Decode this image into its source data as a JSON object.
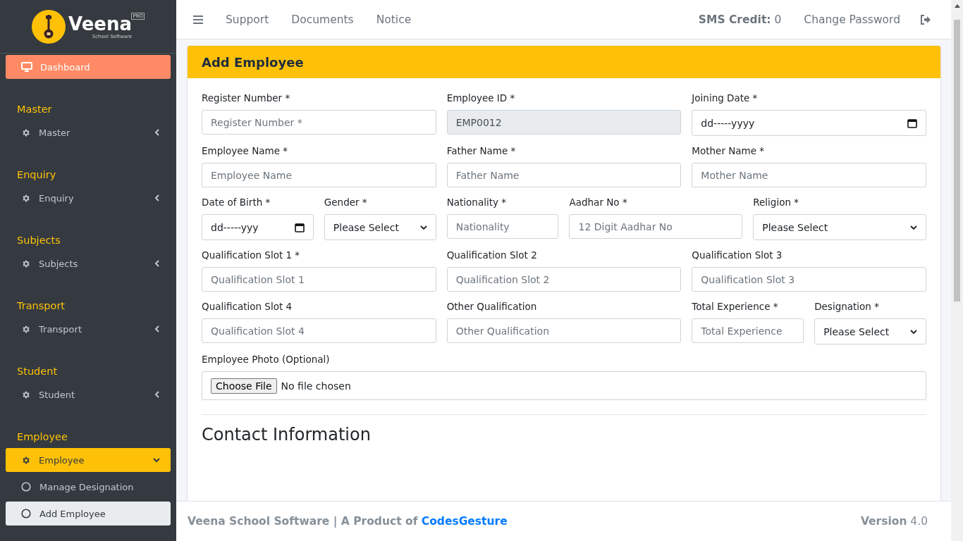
{
  "sidebar": {
    "logo": {
      "name": "Veena",
      "tagline": "School Software",
      "badge": "PRO"
    },
    "dashboard": {
      "label": "Dashboard"
    },
    "sections": [
      {
        "heading": "Master",
        "menu": {
          "label": "Master",
          "expanded": false
        }
      },
      {
        "heading": "Enquiry",
        "menu": {
          "label": "Enquiry",
          "expanded": false
        }
      },
      {
        "heading": "Subjects",
        "menu": {
          "label": "Subjects",
          "expanded": false
        }
      },
      {
        "heading": "Transport",
        "menu": {
          "label": "Transport",
          "expanded": false
        }
      },
      {
        "heading": "Student",
        "menu": {
          "label": "Student",
          "expanded": false
        }
      },
      {
        "heading": "Employee",
        "menu": {
          "label": "Employee",
          "expanded": true
        },
        "children": [
          {
            "label": "Manage Designation",
            "selected": false
          },
          {
            "label": "Add Employee",
            "selected": true
          }
        ]
      }
    ]
  },
  "top_nav": {
    "links": [
      "Support",
      "Documents",
      "Notice"
    ],
    "sms_credit": "**SMS Credit:** 0",
    "change_password": "Change Password"
  },
  "form": {
    "title": "Add Employee",
    "fields": [
      {
        "label": "Register Number *",
        "kind": "text",
        "placeholder": "Register Number *",
        "disabled": false
      },
      {
        "label": "Employee ID *",
        "kind": "text",
        "value": "EMP0012",
        "disabled": true
      },
      {
        "label": "Joining Date *",
        "kind": "date",
        "value": "dd-----yyyy",
        "disabled": false
      },
      {
        "label": "Employee Name *",
        "kind": "text",
        "placeholder": "Employee Name",
        "disabled": false
      },
      {
        "label": "Father Name *",
        "kind": "text",
        "placeholder": "Father Name",
        "disabled": false
      },
      {
        "label": "Mother Name *",
        "kind": "text",
        "placeholder": "Mother Name",
        "disabled": false
      },
      {
        "label": "Date of Birth *",
        "kind": "date",
        "value": "dd-----yyy",
        "disabled": false
      },
      {
        "label": "Gender *",
        "kind": "select",
        "value": "Please Select",
        "disabled": false
      },
      {
        "label": "Nationality *",
        "kind": "text",
        "placeholder": "Nationality",
        "disabled": false
      },
      {
        "label": "Aadhar No *",
        "kind": "text",
        "placeholder": "12 Digit Aadhar No",
        "disabled": false
      },
      {
        "label": "Religion *",
        "kind": "select",
        "value": "Please Select",
        "disabled": false
      },
      {
        "label": "Qualification Slot 1 *",
        "kind": "text",
        "placeholder": "Qualification Slot 1",
        "disabled": false
      },
      {
        "label": "Qualification Slot 2",
        "kind": "text",
        "placeholder": "Qualification Slot 2",
        "disabled": false
      },
      {
        "label": "Qualification Slot 3",
        "kind": "text",
        "placeholder": "Qualification Slot 3",
        "disabled": false
      },
      {
        "label": "Qualification Slot 4",
        "kind": "text",
        "placeholder": "Qualification Slot 4",
        "disabled": false
      },
      {
        "label": "Other Qualification",
        "kind": "text",
        "placeholder": "Other Qualification",
        "disabled": false
      },
      {
        "label": "Total Experience *",
        "kind": "text",
        "placeholder": "Total Experience",
        "disabled": false
      },
      {
        "label": "Designation *",
        "kind": "select",
        "value": "Please Select",
        "disabled": false
      },
      {
        "label": "Employee Photo (Optional)",
        "kind": "file",
        "button": "Choose File",
        "value": "No file chosen",
        "disabled": false
      }
    ],
    "section_heading": "Contact Information"
  },
  "footer": {
    "credit": "Veena School Software | A Product of",
    "link": "CodesGesture",
    "version": "**Version** 4.0"
  }
}
